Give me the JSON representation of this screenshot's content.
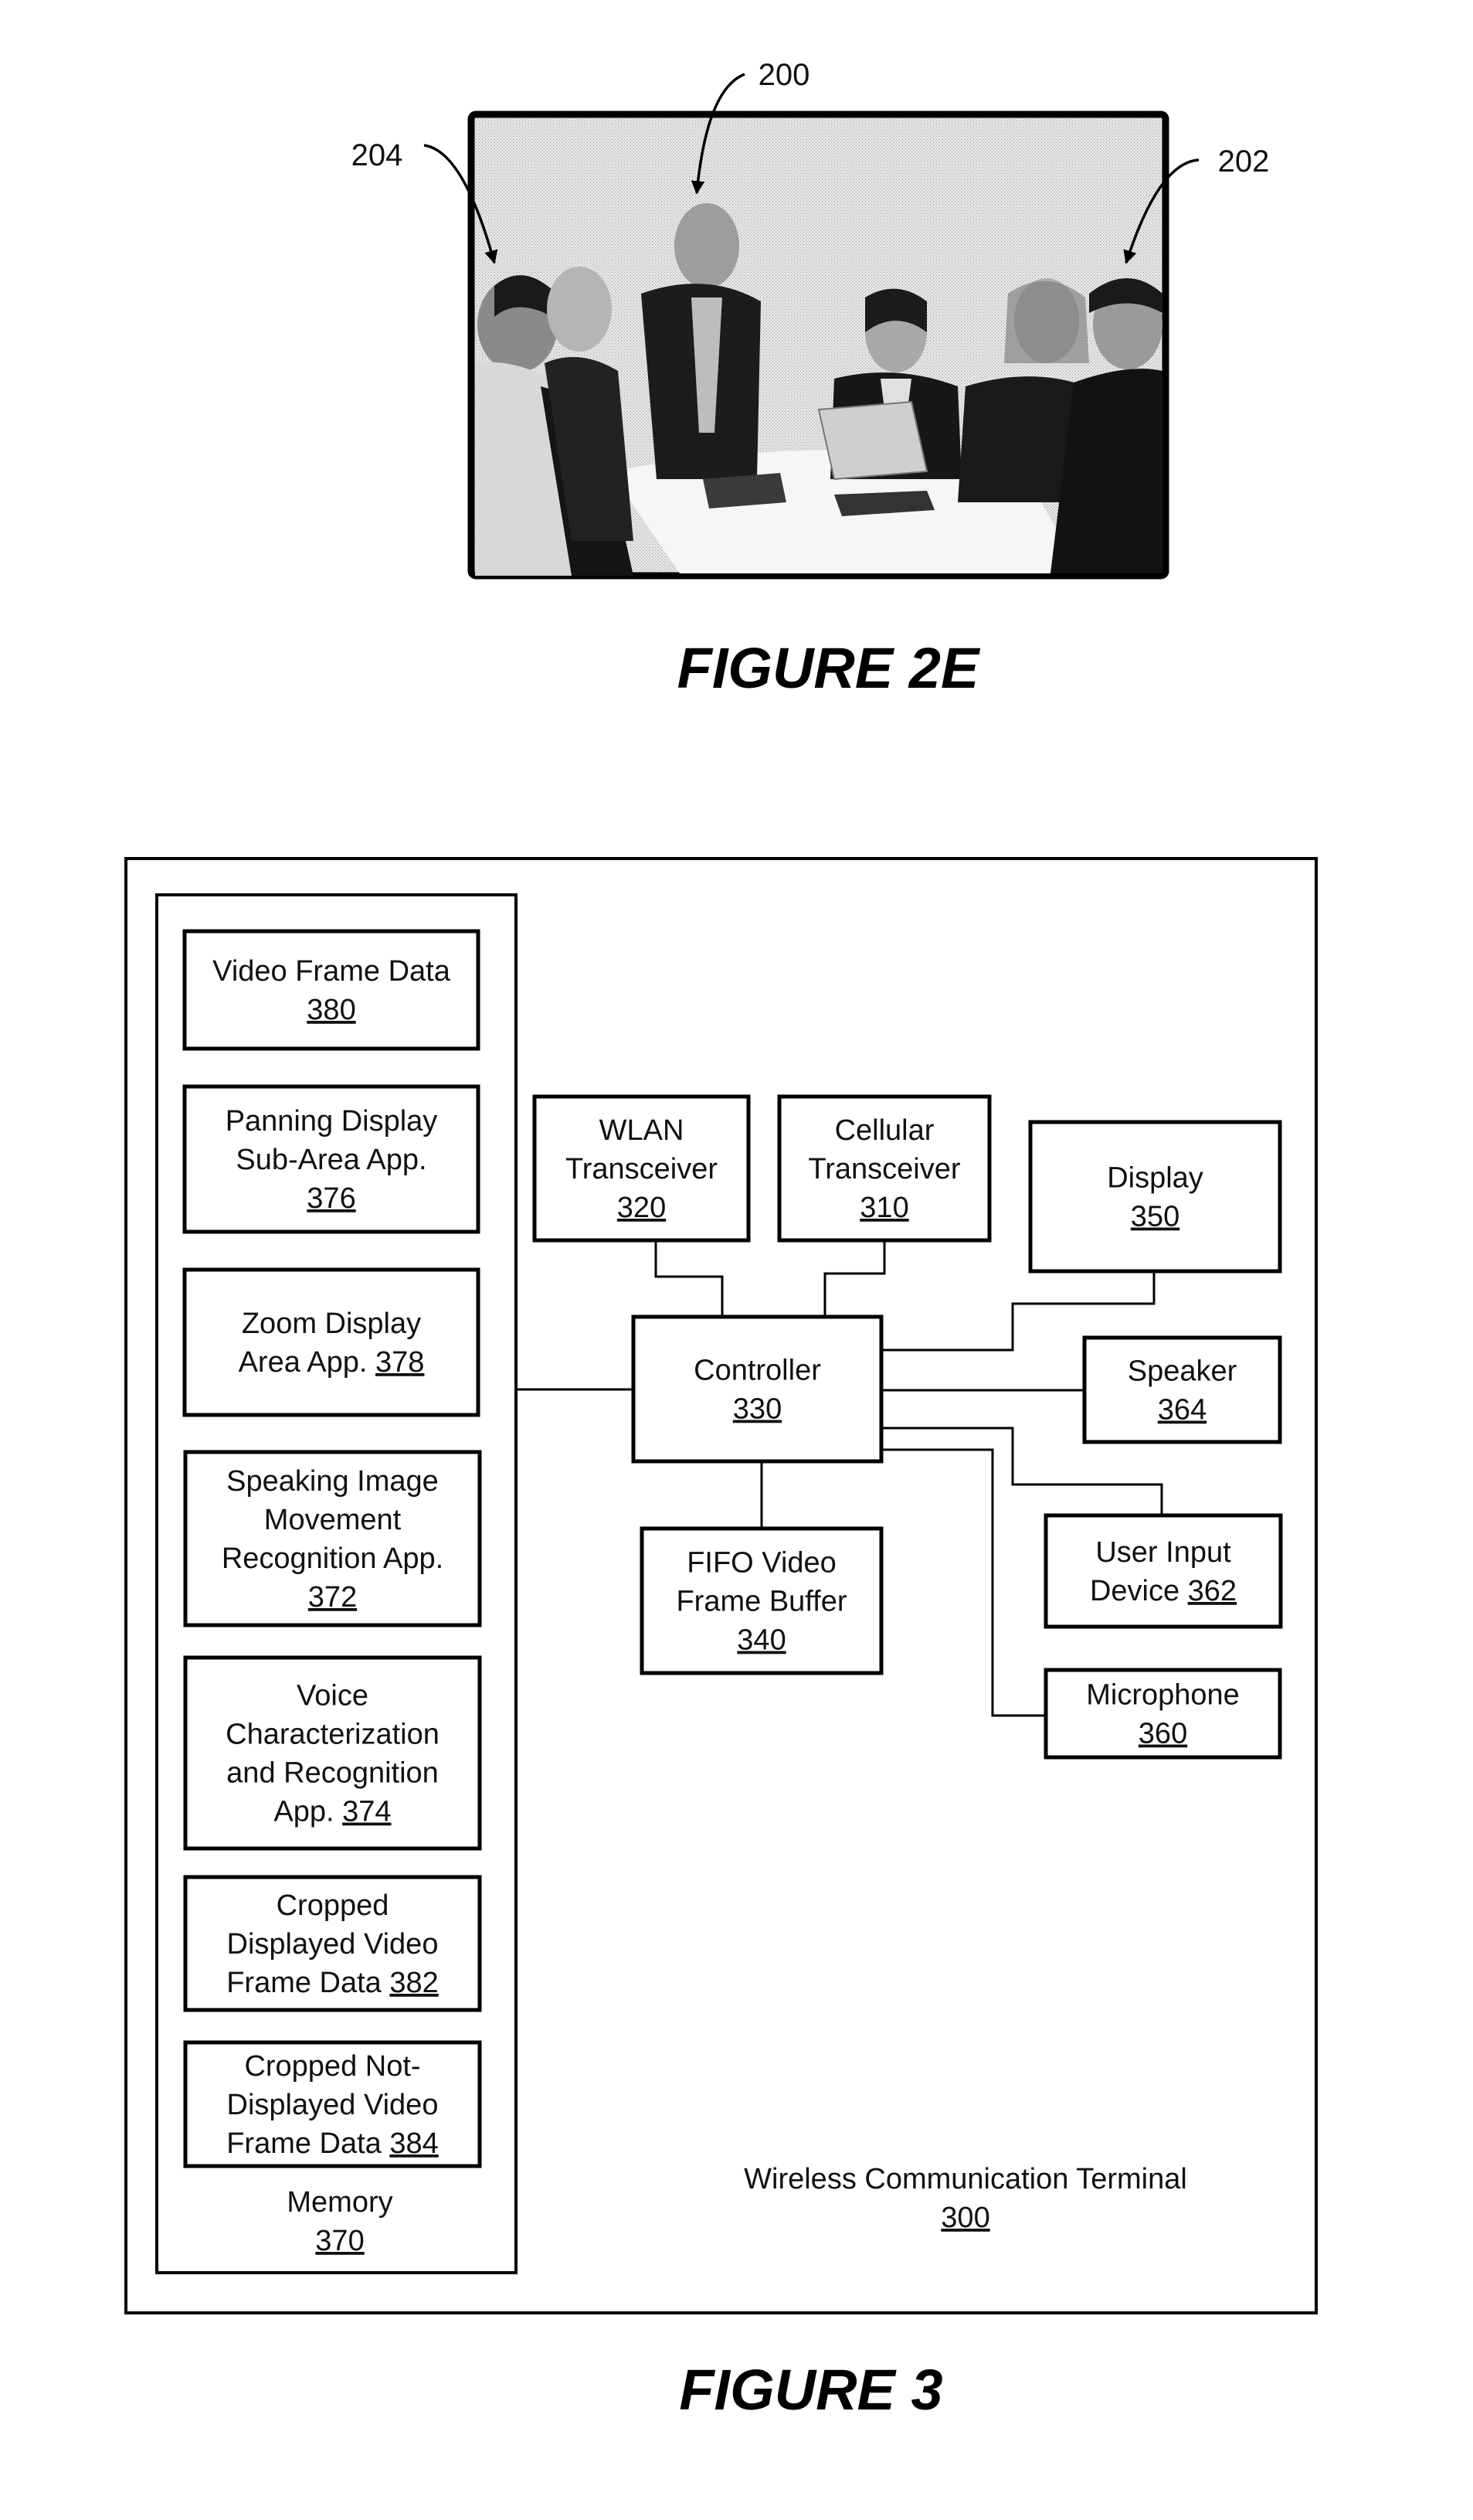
{
  "figure_2e": {
    "caption": "FIGURE 2E",
    "photo_description": "grayscale photo of six business people around a conference table",
    "labels": {
      "frame": "200",
      "right_person": "202",
      "left_person": "204"
    }
  },
  "figure_3": {
    "caption": "FIGURE 3",
    "terminal": {
      "name": "Wireless Communication Terminal",
      "ref": "300"
    },
    "memory": {
      "name": "Memory",
      "ref": "370",
      "items": [
        {
          "lines": [
            "Video Frame Data"
          ],
          "ref": "380",
          "ref_inline": false
        },
        {
          "lines": [
            "Panning Display",
            "Sub-Area App."
          ],
          "ref": "376",
          "ref_inline": false
        },
        {
          "lines": [
            "Zoom Display",
            "Area App."
          ],
          "ref": "378",
          "ref_inline": true
        },
        {
          "lines": [
            "Speaking Image",
            "Movement",
            "Recognition App."
          ],
          "ref": "372",
          "ref_inline": false
        },
        {
          "lines": [
            "Voice",
            "Characterization",
            "and Recognition",
            "App."
          ],
          "ref": "374",
          "ref_inline": true
        },
        {
          "lines": [
            "Cropped",
            "Displayed Video",
            "Frame Data"
          ],
          "ref": "382",
          "ref_inline": true
        },
        {
          "lines": [
            "Cropped Not-",
            "Displayed Video",
            "Frame Data"
          ],
          "ref": "384",
          "ref_inline": true
        }
      ]
    },
    "components": {
      "wlan": {
        "lines": [
          "WLAN",
          "Transceiver"
        ],
        "ref": "320"
      },
      "cellular": {
        "lines": [
          "Cellular",
          "Transceiver"
        ],
        "ref": "310"
      },
      "display": {
        "lines": [
          "Display"
        ],
        "ref": "350"
      },
      "controller": {
        "lines": [
          "Controller"
        ],
        "ref": "330"
      },
      "speaker": {
        "lines": [
          "Speaker"
        ],
        "ref": "364"
      },
      "fifo": {
        "lines": [
          "FIFO Video",
          "Frame Buffer"
        ],
        "ref": "340"
      },
      "user_input": {
        "lines": [
          "User Input",
          "Device"
        ],
        "ref": "362",
        "ref_inline": true
      },
      "microphone": {
        "lines": [
          "Microphone"
        ],
        "ref": "360"
      }
    }
  }
}
